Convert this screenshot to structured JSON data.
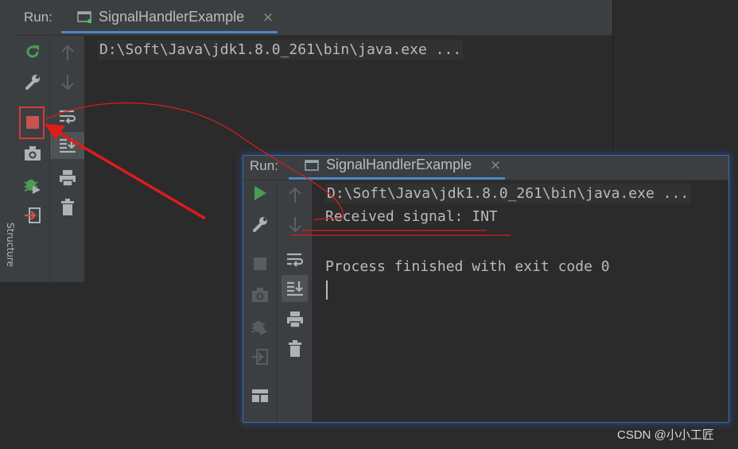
{
  "background_side_label": "Structure",
  "back_window": {
    "run_label": "Run:",
    "tab": {
      "title": "SignalHandlerExample",
      "close": "×"
    },
    "console_lines": [
      "D:\\Soft\\Java\\jdk1.8.0_261\\bin\\java.exe ..."
    ]
  },
  "front_window": {
    "run_label": "Run:",
    "tab": {
      "title": "SignalHandlerExample",
      "close": "×"
    },
    "console_lines": [
      "D:\\Soft\\Java\\jdk1.8.0_261\\bin\\java.exe ...",
      "Received signal: INT",
      "",
      "Process finished with exit code 0"
    ]
  },
  "toolbar_primary": [
    "rerun-icon",
    "settings-wrench-icon",
    "stop-icon",
    "snapshot-camera-icon",
    "debug-bug-icon",
    "exit-icon",
    "layout-icon"
  ],
  "toolbar_secondary": [
    "arrow-up-icon",
    "arrow-down-icon",
    "soft-wrap-icon",
    "scroll-to-end-icon",
    "print-icon",
    "trash-icon"
  ],
  "colors": {
    "rerun_green": "#499c54",
    "stop_red": "#c75450",
    "annotation_red": "#e01b1b",
    "tab_underline": "#4a88c7"
  },
  "watermark": "CSDN @小小工匠"
}
